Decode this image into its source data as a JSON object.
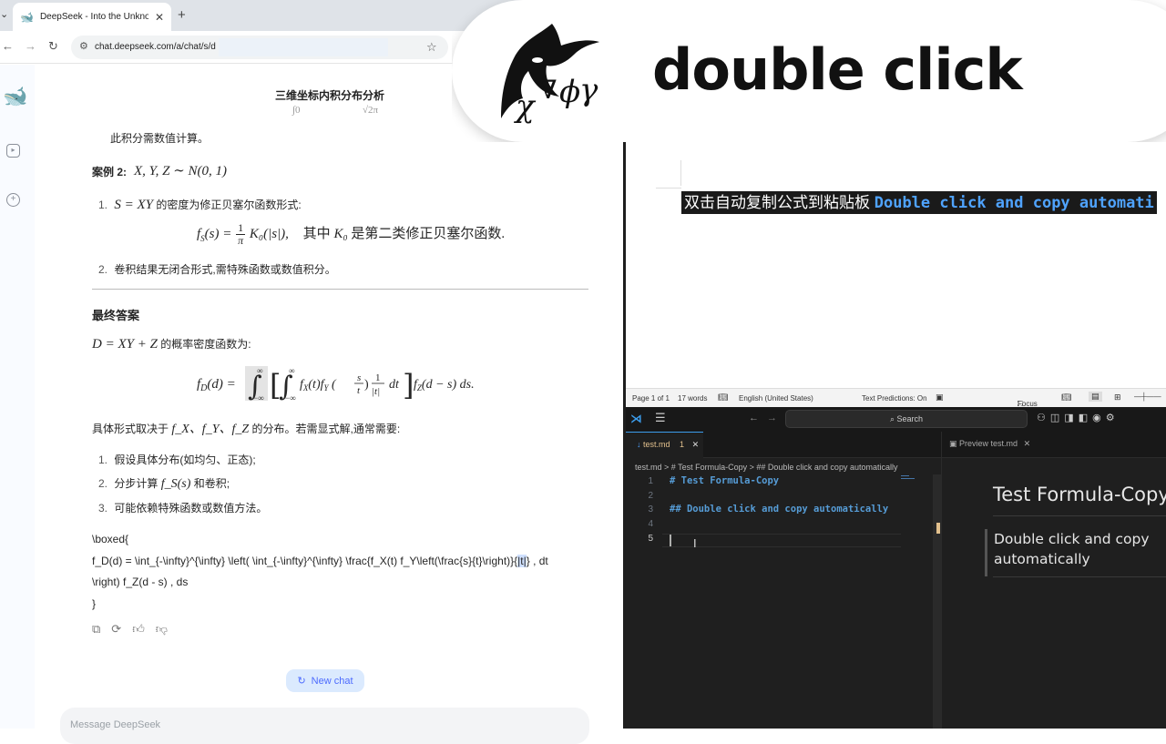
{
  "browser": {
    "tab_title": "DeepSeek - Into the Unknown",
    "url": "chat.deepseek.com/a/chat/s/d",
    "new_tab": "+",
    "tab_close": "✕"
  },
  "chat": {
    "title": "三维坐标内积分布分析",
    "ghost_left": "∫0",
    "ghost_right": "√2π",
    "note": "此积分需数值计算。",
    "case2_label": "案例 2:",
    "case2_math": "X, Y, Z ∼ N(0, 1)",
    "item1_num": "1.",
    "item1_math": "S = XY",
    "item1_text": "的密度为修正贝塞尔函数形式:",
    "eq1_lhs": "f",
    "eq1_sub": "S",
    "eq1_mid": "(s) =",
    "eq1_num": "1",
    "eq1_den": "π",
    "eq1_rhs": "K₀(|s|),",
    "eq1_where": "其中",
    "eq1_k": "K₀",
    "eq1_tail": "是第二类修正贝塞尔函数.",
    "item2_num": "2.",
    "item2_text": "卷积结果无闭合形式,需特殊函数或数值积分。",
    "final_heading": "最终答案",
    "final_math": "D = XY + Z",
    "final_text": "的概率密度函数为:",
    "eq2_text": "f_D(d) = ∫ [∫ f_X(t) f_Y(s/t) 1/|t| dt] f_Z(d − s) ds.",
    "depends_pre": "具体形式取决于",
    "depends_math": "f_X、f_Y、f_Z",
    "depends_post": "的分布。若需显式解,通常需要:",
    "steps": [
      {
        "num": "1.",
        "text": "假设具体分布(如均匀、正态);"
      },
      {
        "num": "2.",
        "pre": "分步计算",
        "math": "f_S(s)",
        "post": "和卷积;"
      },
      {
        "num": "3.",
        "text": "可能依赖特殊函数或数值方法。"
      }
    ],
    "latex_l1": "\\boxed{",
    "latex_l2a": "f_D(d) = \\int_{-\\infty}^{\\infty} \\left( \\int_{-\\infty}^{\\infty} \\frac{f_X(t) f_Y\\left(\\frac{s}{t}\\right)}{",
    "latex_l2sel": "|t|",
    "latex_l2b": "} , dt",
    "latex_l3": "\\right) f_Z(d - s) , ds",
    "latex_l4": "}",
    "new_chat": "New chat",
    "message_placeholder": "Message DeepSeek"
  },
  "overlay": {
    "label": "double click"
  },
  "word": {
    "text_cn": "双击自动复制公式到粘贴板",
    "text_en": "Double click and copy automati",
    "status_page": "Page 1 of 1",
    "status_words": "17 words",
    "status_lang": "English (United States)",
    "status_predict": "Text Predictions: On",
    "status_focus": "Focus"
  },
  "vscode": {
    "search": "Search",
    "tab_file": "test.md",
    "tab_badge": "1",
    "tab_preview": "Preview test.md",
    "breadcrumb": "test.md > # Test Formula-Copy > ## Double click and copy automatically",
    "lines": [
      {
        "n": "1",
        "code": "# Test Formula-Copy"
      },
      {
        "n": "2",
        "code": ""
      },
      {
        "n": "3",
        "code": "## Double click and copy automatically"
      },
      {
        "n": "4",
        "code": ""
      },
      {
        "n": "5",
        "code": ""
      }
    ],
    "preview_h1": "Test Formula-Copy",
    "preview_h2": "Double click and copy automatically"
  },
  "colors": {
    "deepseek_blue": "#4d6bfe",
    "vscode_heading": "#569cd6",
    "vscode_modified": "#e2c08d"
  }
}
